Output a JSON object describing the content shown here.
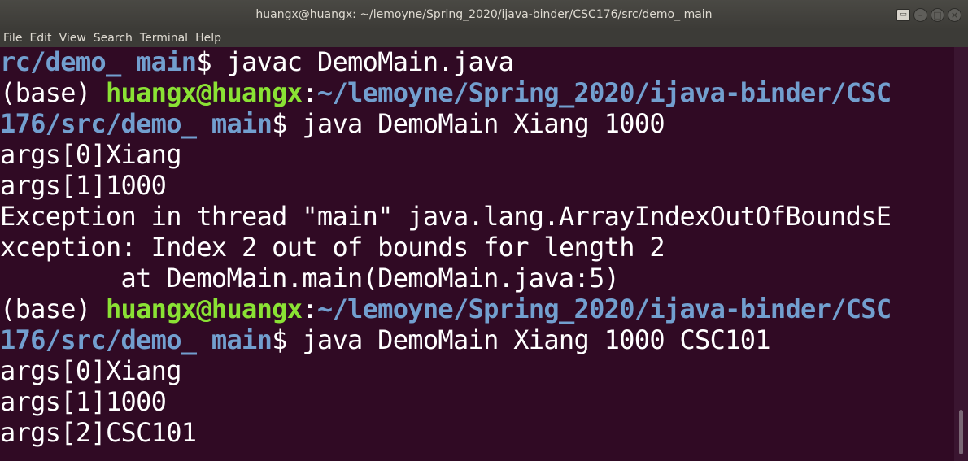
{
  "window": {
    "title": "huangx@huangx: ~/lemoyne/Spring_2020/ijava-binder/CSC176/src/demo_ main",
    "buttons": [
      "terminal-icon",
      "minimize",
      "maximize",
      "close"
    ]
  },
  "menu": [
    "File",
    "Edit",
    "View",
    "Search",
    "Terminal",
    "Help"
  ],
  "terminal": {
    "lines": [
      {
        "b": "rc/demo_ main",
        "t": "$ javac DemoMain.java"
      },
      {
        "t": "(base) ",
        "g": "huangx@huangx",
        "t2": ":",
        "b": "~/lemoyne/Spring_2020/ijava-binder/CSC"
      },
      {
        "b": "176/src/demo_ main",
        "t": "$ java DemoMain Xiang 1000"
      },
      {
        "t": "args[0]Xiang"
      },
      {
        "t": "args[1]1000"
      },
      {
        "t": "Exception in thread \"main\" java.lang.ArrayIndexOutOfBoundsE"
      },
      {
        "t": "xception: Index 2 out of bounds for length 2"
      },
      {
        "t": "        at DemoMain.main(DemoMain.java:5)"
      },
      {
        "t": "(base) ",
        "g": "huangx@huangx",
        "t2": ":",
        "b": "~/lemoyne/Spring_2020/ijava-binder/CSC"
      },
      {
        "b": "176/src/demo_ main",
        "t": "$ java DemoMain Xiang 1000 CSC101"
      },
      {
        "t": "args[0]Xiang"
      },
      {
        "t": "args[1]1000"
      },
      {
        "t": "args[2]CSC101"
      }
    ]
  },
  "colors": {
    "background": "#300a24",
    "prompt_user": "#8ae234",
    "prompt_path": "#729fcf",
    "text": "#ffffff"
  }
}
